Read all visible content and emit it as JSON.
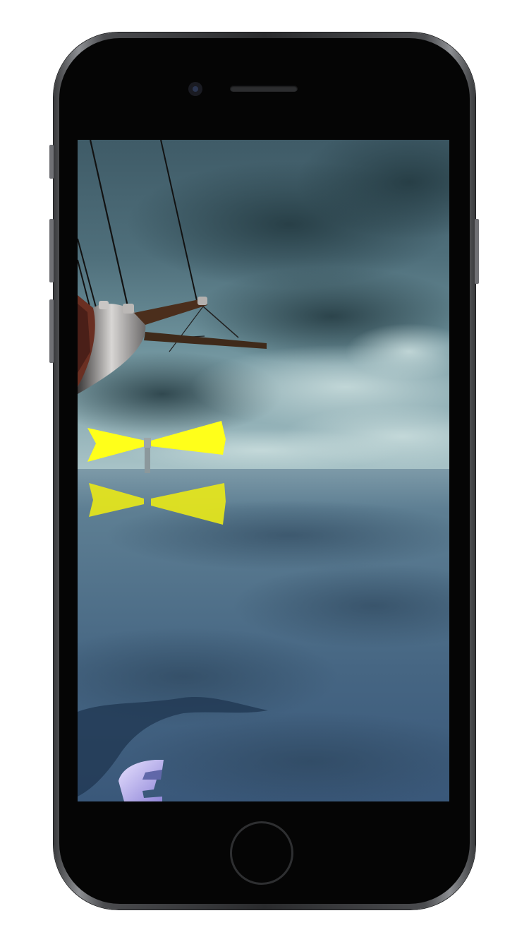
{
  "device": {
    "model": "iphone",
    "frame_color": "#2a2b2d"
  },
  "scene": {
    "type": "3d-ocean-game",
    "sky_colors": [
      "#3d5965",
      "#6f93a0",
      "#a9c5cc"
    ],
    "sea_colors": [
      "#5d7e90",
      "#3e5b72",
      "#2f4862"
    ],
    "beam_color": "#ffff1a",
    "objects": [
      {
        "name": "ship-bow",
        "icon": "ship-icon"
      },
      {
        "name": "lighthouse",
        "icon": "lighthouse-icon"
      },
      {
        "name": "lighthouse-reflection",
        "icon": "reflection-icon"
      },
      {
        "name": "player-boat-stern",
        "icon": "boat-icon"
      }
    ]
  }
}
